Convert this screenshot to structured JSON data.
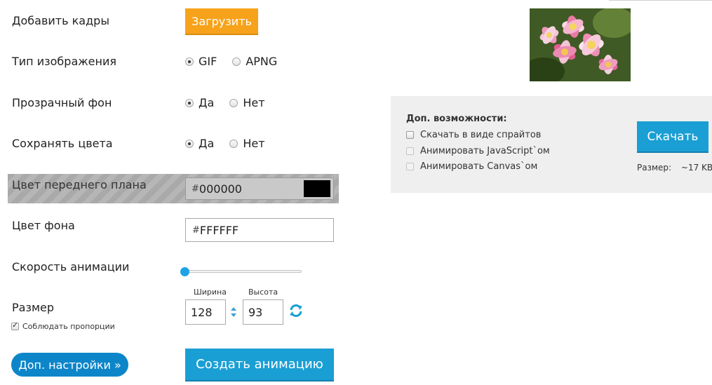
{
  "add_frames": {
    "label": "Добавить кадры",
    "button": "Загрузить"
  },
  "image_type": {
    "label": "Тип изображения",
    "options": [
      "GIF",
      "APNG"
    ],
    "selected": "GIF"
  },
  "transparent_bg": {
    "label": "Прозрачный фон",
    "options": [
      "Да",
      "Нет"
    ],
    "selected": "Да"
  },
  "keep_colors": {
    "label": "Сохранять цвета",
    "options": [
      "Да",
      "Нет"
    ],
    "selected": "Да"
  },
  "fg_color": {
    "label": "Цвет переднего плана",
    "hash": "#",
    "value": "000000",
    "swatch": "#000000"
  },
  "bg_color": {
    "label": "Цвет фона",
    "hash": "#",
    "value": "FFFFFF"
  },
  "anim_speed": {
    "label": "Скорость анимации",
    "level": 0
  },
  "size": {
    "label": "Размер",
    "width_label": "Ширина",
    "width": "128",
    "height_label": "Высота",
    "height": "93",
    "keep_ratio": "Соблюдать пропорции"
  },
  "buttons": {
    "more_settings": "Доп. настройки »",
    "create": "Создать анимацию"
  },
  "extras": {
    "title": "Доп. возможности:",
    "options": [
      "Скачать в виде спрайтов",
      "Анимировать JavaScript`ом",
      "Анимировать Canvas`ом"
    ],
    "download": "Скачать",
    "size_label": "Размер:",
    "size_value": "~17 KB"
  },
  "colors": {
    "accent": "#1a9fd4",
    "upload": "#f7a21b",
    "more": "#0d86c9",
    "slider": "#1fa3e6"
  }
}
